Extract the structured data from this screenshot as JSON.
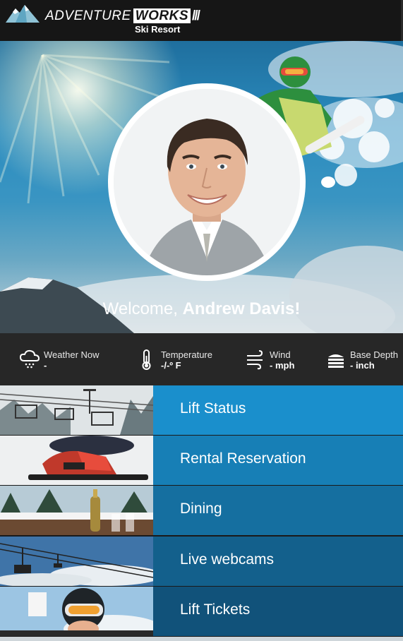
{
  "header": {
    "brand_light": "ADVENTURE",
    "brand_bold": "WORKS",
    "brand_slashes": "///",
    "subtitle": "Ski Resort"
  },
  "profile": {
    "welcome_prefix": "Welcome, ",
    "user_name": "Andrew Davis!"
  },
  "stats": [
    {
      "label": "Weather Now",
      "value": "-",
      "icon": "cloud-snow-icon"
    },
    {
      "label": "Temperature",
      "value": "-/-º F",
      "icon": "thermometer-icon"
    },
    {
      "label": "Wind",
      "value": "- mph",
      "icon": "wind-icon"
    },
    {
      "label": "Base Depth",
      "value": "- inch",
      "icon": "snow-layers-icon"
    }
  ],
  "menu": [
    {
      "label": "Lift Status",
      "color": "#1a8fcc",
      "thumb": "chairlift-photo"
    },
    {
      "label": "Rental Reservation",
      "color": "#177fb6",
      "thumb": "ski-boots-photo"
    },
    {
      "label": "Dining",
      "color": "#156fa0",
      "thumb": "champagne-snow-photo"
    },
    {
      "label": "Live webcams",
      "color": "#13608c",
      "thumb": "lift-sky-photo"
    },
    {
      "label": "Lift Tickets",
      "color": "#11527a",
      "thumb": "skier-goggles-photo"
    }
  ]
}
